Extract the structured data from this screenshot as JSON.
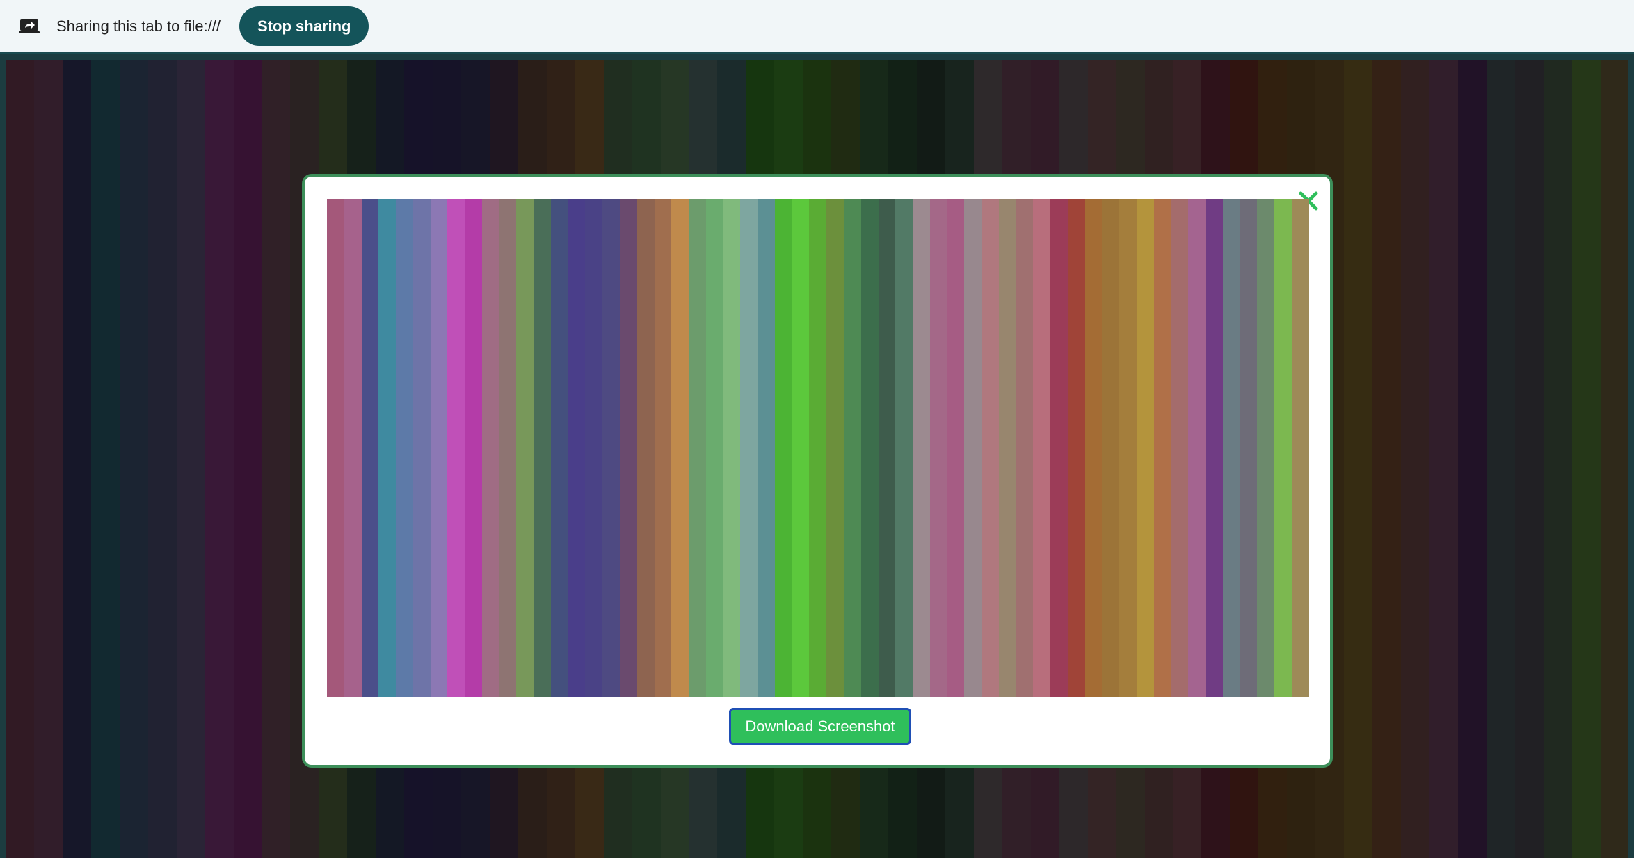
{
  "share_bar": {
    "icon": "screen-share-icon",
    "text": "Sharing this tab to file:///",
    "stop_label": "Stop sharing"
  },
  "modal": {
    "close_icon": "close-icon",
    "download_label": "Download Screenshot",
    "accent_color": "#2fbf5b"
  },
  "stripe_colors": [
    "#a4587a",
    "#a6628c",
    "#4b4f8a",
    "#3f8aa0",
    "#5d7aa8",
    "#6e74a8",
    "#8c78b4",
    "#c050b8",
    "#b43ca8",
    "#a06c84",
    "#8e7472",
    "#78985a",
    "#4a6e58",
    "#44507e",
    "#4a3e8a",
    "#4a4286",
    "#4e4a82",
    "#6a4a6e",
    "#8e6450",
    "#a06e4e",
    "#c08a4c",
    "#6c9c6c",
    "#6aac6e",
    "#80ba7c",
    "#7ea6a0",
    "#5c9094",
    "#4cb434",
    "#5cc83c",
    "#5aac34",
    "#6c903c",
    "#4e8a54",
    "#3c6e4c",
    "#3e5c4c",
    "#527a66",
    "#9c8a90",
    "#a46888",
    "#a65c84",
    "#98888e",
    "#b0787e",
    "#98866e",
    "#a07070",
    "#b86e7c",
    "#9c3c58",
    "#a04438",
    "#a46c34",
    "#9c7438",
    "#a47e3c",
    "#b4943c",
    "#b07048",
    "#a46c6c",
    "#a46490",
    "#703c84",
    "#6a7c84",
    "#6e6c78",
    "#6c8a6c",
    "#7cb850",
    "#9e8a58"
  ]
}
